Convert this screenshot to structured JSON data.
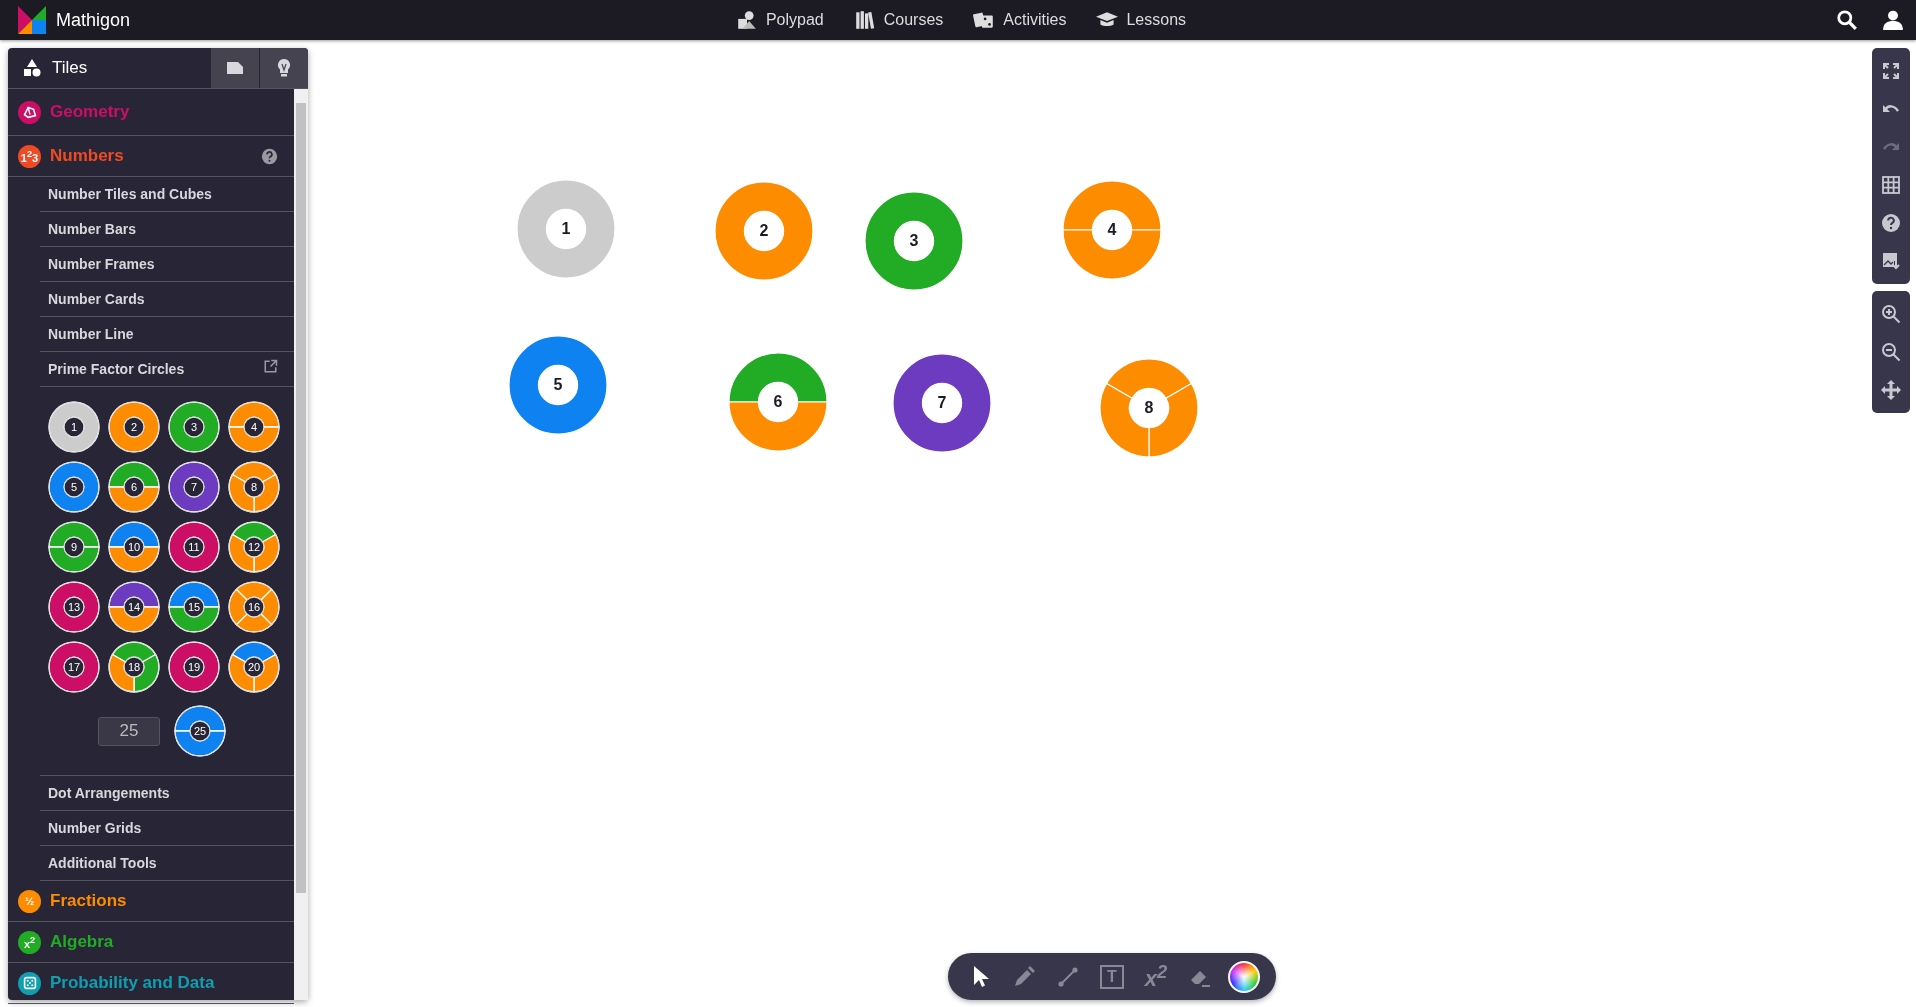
{
  "topbar": {
    "brand": "Mathigon",
    "nav": [
      {
        "label": "Polypad"
      },
      {
        "label": "Courses"
      },
      {
        "label": "Activities"
      },
      {
        "label": "Lessons"
      }
    ]
  },
  "sidebar": {
    "title": "Tiles",
    "sections": [
      {
        "label": "Geometry",
        "color": "#cd0e66",
        "expanded": false
      },
      {
        "label": "Numbers",
        "color": "#f04a24",
        "badge": "1$^{2}$3",
        "expanded": true,
        "children": [
          {
            "label": "Number Tiles and Cubes",
            "expanded": false
          },
          {
            "label": "Number Bars",
            "expanded": false
          },
          {
            "label": "Number Frames",
            "expanded": false
          },
          {
            "label": "Number Cards",
            "expanded": false
          },
          {
            "label": "Number Line",
            "expanded": false
          },
          {
            "label": "Prime Factor Circles",
            "expanded": true,
            "input_value": "25",
            "circles": [
              {
                "number": "1",
                "segments": [
                  {
                    "color": "#cccccc"
                  }
                ]
              },
              {
                "number": "2",
                "segments": [
                  {
                    "color": "#fd8c00"
                  }
                ]
              },
              {
                "number": "3",
                "segments": [
                  {
                    "color": "#22ab24"
                  }
                ]
              },
              {
                "number": "4",
                "segments": [
                  {
                    "color": "#fd8c00"
                  },
                  {
                    "color": "#fd8c00"
                  }
                ]
              },
              {
                "number": "5",
                "segments": [
                  {
                    "color": "#0f82f2"
                  }
                ]
              },
              {
                "number": "6",
                "segments": [
                  {
                    "color": "#22ab24"
                  },
                  {
                    "color": "#fd8c00"
                  }
                ]
              },
              {
                "number": "7",
                "segments": [
                  {
                    "color": "#6d3bbf"
                  }
                ]
              },
              {
                "number": "8",
                "segments": [
                  {
                    "color": "#fd8c00"
                  },
                  {
                    "color": "#fd8c00"
                  },
                  {
                    "color": "#fd8c00"
                  }
                ]
              },
              {
                "number": "9",
                "segments": [
                  {
                    "color": "#22ab24"
                  },
                  {
                    "color": "#22ab24"
                  }
                ]
              },
              {
                "number": "10",
                "segments": [
                  {
                    "color": "#0f82f2"
                  },
                  {
                    "color": "#fd8c00"
                  }
                ]
              },
              {
                "number": "11",
                "segments": [
                  {
                    "color": "#cd0e66"
                  }
                ]
              },
              {
                "number": "12",
                "segments": [
                  {
                    "color": "#22ab24"
                  },
                  {
                    "color": "#fd8c00"
                  },
                  {
                    "color": "#fd8c00"
                  }
                ]
              },
              {
                "number": "13",
                "segments": [
                  {
                    "color": "#cd0e66"
                  }
                ]
              },
              {
                "number": "14",
                "segments": [
                  {
                    "color": "#6d3bbf"
                  },
                  {
                    "color": "#fd8c00"
                  }
                ]
              },
              {
                "number": "15",
                "segments": [
                  {
                    "color": "#0f82f2"
                  },
                  {
                    "color": "#22ab24"
                  }
                ]
              },
              {
                "number": "16",
                "segments": [
                  {
                    "color": "#fd8c00"
                  },
                  {
                    "color": "#fd8c00"
                  },
                  {
                    "color": "#fd8c00"
                  },
                  {
                    "color": "#fd8c00"
                  }
                ]
              },
              {
                "number": "17",
                "segments": [
                  {
                    "color": "#cd0e66"
                  }
                ]
              },
              {
                "number": "18",
                "segments": [
                  {
                    "color": "#22ab24"
                  },
                  {
                    "color": "#22ab24"
                  },
                  {
                    "color": "#fd8c00"
                  }
                ]
              },
              {
                "number": "19",
                "segments": [
                  {
                    "color": "#cd0e66"
                  }
                ]
              },
              {
                "number": "20",
                "segments": [
                  {
                    "color": "#0f82f2"
                  },
                  {
                    "color": "#fd8c00"
                  },
                  {
                    "color": "#fd8c00"
                  }
                ]
              }
            ],
            "preview": {
              "number": "25",
              "segments": [
                {
                  "color": "#0f82f2"
                },
                {
                  "color": "#0f82f2"
                }
              ]
            }
          },
          {
            "label": "Dot Arrangements",
            "expanded": false
          },
          {
            "label": "Number Grids",
            "expanded": false
          },
          {
            "label": "Additional Tools",
            "expanded": false
          }
        ]
      },
      {
        "label": "Fractions",
        "color": "#fd8c00",
        "badge": "½",
        "expanded": false
      },
      {
        "label": "Algebra",
        "color": "#22ab24",
        "badge": "x$^{2}$",
        "expanded": false
      },
      {
        "label": "Probability and Data",
        "color": "#0f9fb0",
        "expanded": false
      }
    ]
  },
  "canvas": {
    "circles": [
      {
        "number": "1",
        "segments": [
          {
            "color": "#cccccc"
          }
        ]
      },
      {
        "number": "2",
        "segments": [
          {
            "color": "#fd8c00"
          }
        ]
      },
      {
        "number": "3",
        "segments": [
          {
            "color": "#22ab24"
          }
        ]
      },
      {
        "number": "4",
        "segments": [
          {
            "color": "#fd8c00"
          },
          {
            "color": "#fd8c00"
          }
        ]
      },
      {
        "number": "5",
        "segments": [
          {
            "color": "#0f82f2"
          }
        ]
      },
      {
        "number": "6",
        "segments": [
          {
            "color": "#22ab24"
          },
          {
            "color": "#fd8c00"
          }
        ]
      },
      {
        "number": "7",
        "segments": [
          {
            "color": "#6d3bbf"
          }
        ]
      },
      {
        "number": "8",
        "segments": [
          {
            "color": "#fd8c00"
          },
          {
            "color": "#fd8c00"
          },
          {
            "color": "#fd8c00"
          }
        ]
      }
    ]
  },
  "right_toolbar": {
    "groups": [
      [
        {
          "kind": "fullscreen",
          "disabled": false
        },
        {
          "kind": "undo",
          "disabled": false
        },
        {
          "kind": "redo",
          "disabled": true
        },
        {
          "kind": "grid",
          "disabled": false
        },
        {
          "kind": "help",
          "disabled": false
        },
        {
          "kind": "export",
          "disabled": false
        }
      ],
      [
        {
          "kind": "zoom-in",
          "disabled": false
        },
        {
          "kind": "zoom-out",
          "disabled": false
        },
        {
          "kind": "pan",
          "disabled": false
        }
      ]
    ]
  },
  "bottom_toolbar": {
    "tools": [
      {
        "kind": "select",
        "selected": true
      },
      {
        "kind": "pen",
        "selected": false
      },
      {
        "kind": "line",
        "selected": false
      },
      {
        "kind": "text",
        "glyph": "T",
        "selected": false
      },
      {
        "kind": "equation",
        "glyph": "x$^{2}$",
        "selected": false
      },
      {
        "kind": "eraser",
        "selected": false
      },
      {
        "kind": "color",
        "selected": false
      }
    ]
  }
}
